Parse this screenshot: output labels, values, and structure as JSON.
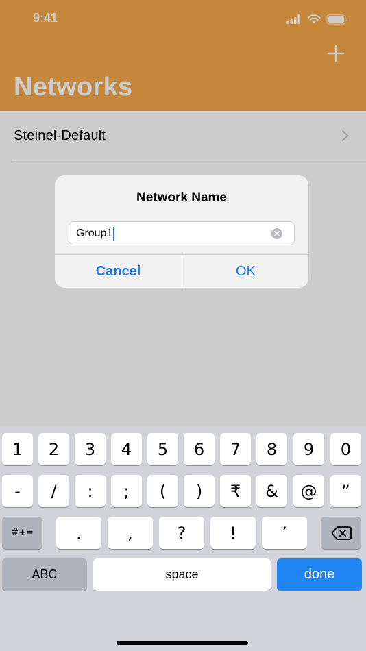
{
  "status_bar": {
    "time": "9:41",
    "icons": [
      "cellular-signal-icon",
      "wifi-icon",
      "battery-icon"
    ]
  },
  "navbar": {
    "title": "Networks",
    "add_icon": "plus-icon",
    "background_color": "#f5a94a"
  },
  "list": {
    "items": [
      {
        "label": "Steinel-Default",
        "accessory": "chevron-right-icon"
      }
    ]
  },
  "alert": {
    "title": "Network Name",
    "input_value": "Group1",
    "clear_icon": "clear-circle-icon",
    "cancel_label": "Cancel",
    "ok_label": "OK",
    "accent_color": "#1a73e8"
  },
  "keyboard": {
    "row1": [
      "1",
      "2",
      "3",
      "4",
      "5",
      "6",
      "7",
      "8",
      "9",
      "0"
    ],
    "row2": [
      "-",
      "/",
      ":",
      ";",
      "(",
      ")",
      "₹",
      "&",
      "@",
      "”"
    ],
    "row3_mode": "#+=",
    "row3": [
      ".",
      ",",
      "?",
      "!",
      "’"
    ],
    "backspace_icon": "backspace-icon",
    "abc_label": "ABC",
    "space_label": "space",
    "done_label": "done"
  }
}
